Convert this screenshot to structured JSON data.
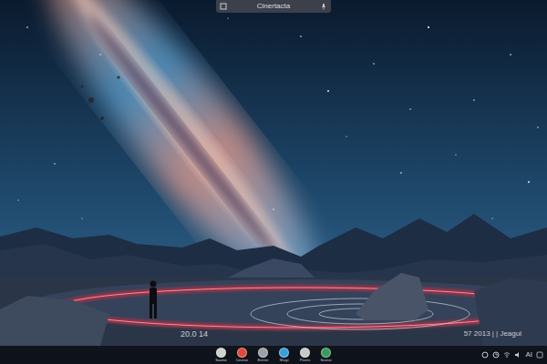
{
  "search_bar": {
    "title": "Cinertacta"
  },
  "desktop_clock": "20.0 14",
  "tray": {
    "text": "57 2013 | | Jeagul",
    "label": "AI"
  },
  "taskbar": {
    "apps": [
      {
        "label": "Saome",
        "color": "#d0d0d0"
      },
      {
        "label": "Cexnse",
        "color": "#e04a3a"
      },
      {
        "label": "Eetrter",
        "color": "#9aa0a6"
      },
      {
        "label": "Shoyt",
        "color": "#3aa0d8"
      },
      {
        "label": "Pezrts",
        "color": "#c8c8c8"
      },
      {
        "label": "Sconst",
        "color": "#3a9a5a"
      }
    ]
  }
}
